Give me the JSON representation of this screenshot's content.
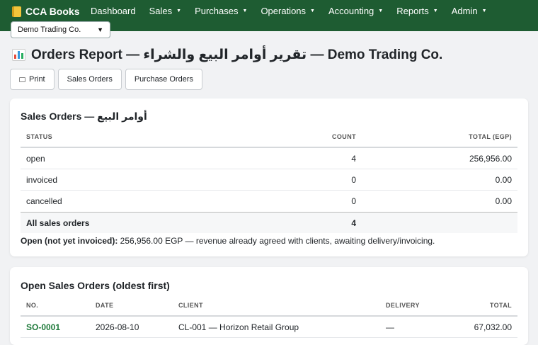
{
  "nav": {
    "brand": "CCA Books",
    "items": [
      {
        "label": "Dashboard",
        "caret": false
      },
      {
        "label": "Sales",
        "caret": true
      },
      {
        "label": "Purchases",
        "caret": true
      },
      {
        "label": "Operations",
        "caret": true
      },
      {
        "label": "Accounting",
        "caret": true
      },
      {
        "label": "Reports",
        "caret": true
      },
      {
        "label": "Admin",
        "caret": true
      }
    ]
  },
  "company_select": {
    "value": "Demo Trading Co."
  },
  "page": {
    "title": "Orders Report — تقرير أوامر البيع والشراء — Demo Trading Co."
  },
  "buttons": {
    "print": "Print",
    "sales_orders": "Sales Orders",
    "purchase_orders": "Purchase Orders"
  },
  "sales_summary": {
    "title": "Sales Orders — أوامر البيع",
    "headers": {
      "status": "STATUS",
      "count": "COUNT",
      "total": "TOTAL (EGP)"
    },
    "rows": [
      {
        "status": "open",
        "count": "4",
        "total": "256,956.00"
      },
      {
        "status": "invoiced",
        "count": "0",
        "total": "0.00"
      },
      {
        "status": "cancelled",
        "count": "0",
        "total": "0.00"
      }
    ],
    "footer": {
      "label": "All sales orders",
      "count": "4"
    },
    "note_label": "Open (not yet invoiced):",
    "note_text": " 256,956.00 EGP — revenue already agreed with clients, awaiting delivery/invoicing."
  },
  "open_orders": {
    "title": "Open Sales Orders (oldest first)",
    "headers": {
      "no": "NO.",
      "date": "DATE",
      "client": "CLIENT",
      "delivery": "DELIVERY",
      "total": "TOTAL"
    },
    "rows": [
      {
        "no": "SO-0001",
        "date": "2026-08-10",
        "client": "CL-001 — Horizon Retail Group",
        "delivery": "—",
        "total": "67,032.00"
      }
    ]
  },
  "colors": {
    "nav_bg": "#1e5c32",
    "link": "#1e7a3a",
    "page_bg": "#f1f2f4"
  }
}
